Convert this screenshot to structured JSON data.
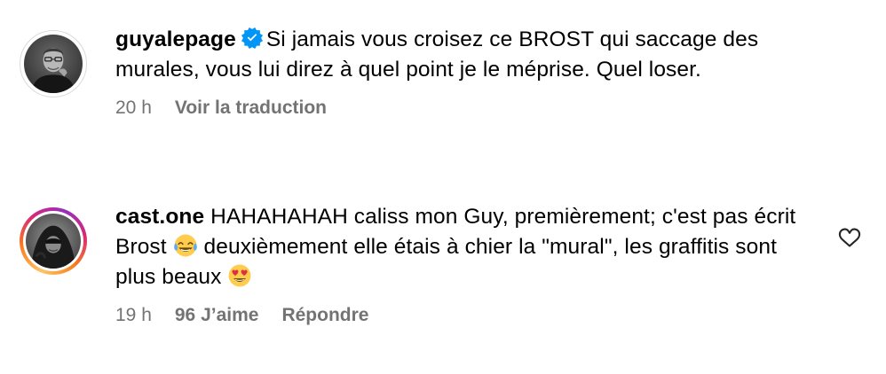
{
  "comments": [
    {
      "username": "guyalepage",
      "verified": true,
      "text": "Si jamais vous croisez ce BROST qui saccage des murales, vous lui direz à quel point je le méprise. Quel loser.",
      "time": "20 h",
      "translate_label": "Voir la traduction",
      "avatar_icon": "avatar-photo-man-glasses"
    },
    {
      "username": "cast.one",
      "verified": false,
      "text_part1": "HAHAHAHAH caliss mon Guy, premièrement; c'est pas écrit Brost",
      "emoji1": "face-with-tears-of-joy",
      "text_part2": "deuxièmement elle étais à chier la \"mural\", les graffitis sont plus beaux",
      "emoji2": "smiling-face-with-heart-eyes",
      "time": "19 h",
      "likes_label": "96 J’aime",
      "reply_label": "Répondre",
      "avatar_icon": "avatar-photo-hooded"
    }
  ],
  "colors": {
    "text": "#000000",
    "meta": "#737373",
    "verified_badge": "#0095f6"
  }
}
